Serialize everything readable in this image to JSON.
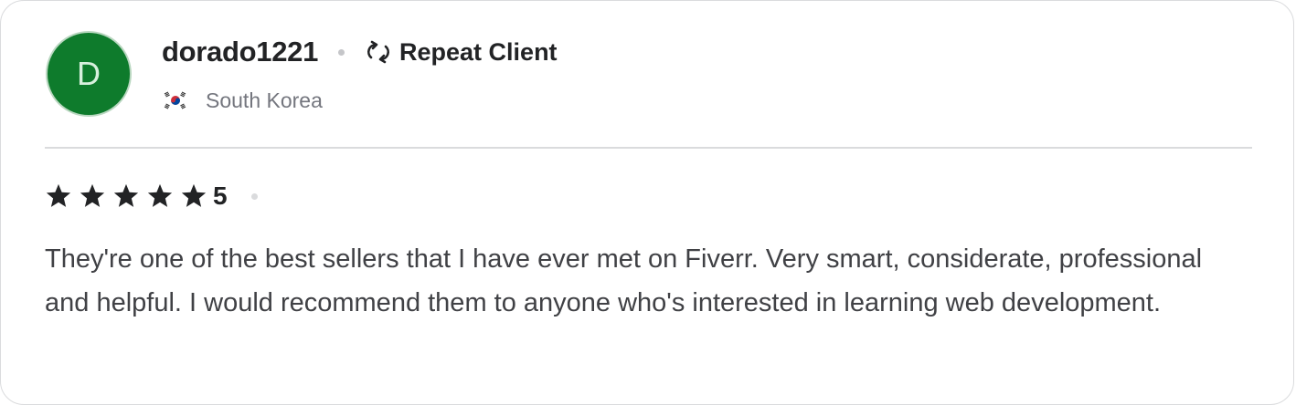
{
  "reviewer": {
    "avatar_initial": "D",
    "avatar_color": "#0e7b2c",
    "username": "dorado1221",
    "badge_label": "Repeat Client",
    "badge_icon": "repeat-icon",
    "country": "South Korea",
    "flag_icon": "south-korea-flag-icon"
  },
  "rating": {
    "stars": 5,
    "max_stars": 5,
    "value": "5"
  },
  "review": {
    "text": "They're one of the best sellers that I have ever met on Fiverr. Very smart, considerate, professional and helpful. I would recommend them to anyone who's interested in learning web development."
  }
}
